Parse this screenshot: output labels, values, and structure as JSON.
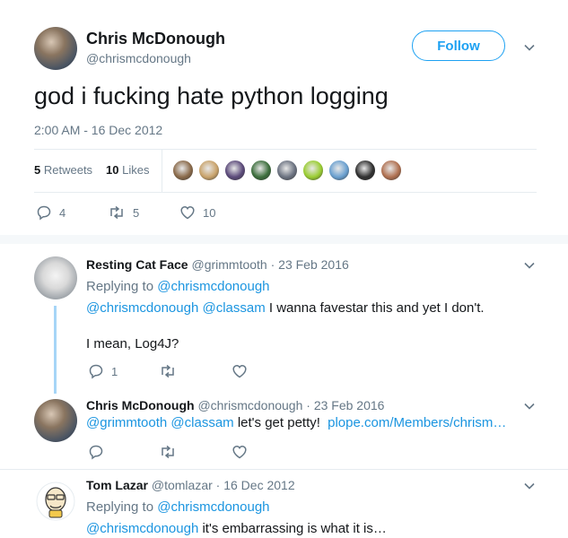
{
  "main_tweet": {
    "author_name": "Chris McDonough",
    "author_handle": "@chrismcdonough",
    "follow_label": "Follow",
    "text": "god i fucking hate python logging",
    "timestamp": "2:00 AM - 16 Dec 2012",
    "retweets_count": "5",
    "retweets_label": "Retweets",
    "likes_count": "10",
    "likes_label": "Likes",
    "likers": [
      "#8a6a4a",
      "#c9a36b",
      "#5b4a7a",
      "#3c6e3c",
      "#6b7280",
      "#9acd32",
      "#6aa0d0",
      "#2f2f2f",
      "#b07050"
    ],
    "reply_count": "4",
    "retweet_action_count": "5",
    "like_action_count": "10"
  },
  "replies": [
    {
      "name": "Resting Cat Face",
      "handle": "@grimmtooth",
      "date": "· 23 Feb 2016",
      "replying_prefix": "Replying to",
      "replying_to": "@chrismcdonough",
      "mention1": "@chrismcdonough",
      "mention2": "@classam",
      "text1": "I wanna favestar this and yet I don't.",
      "text2": "I mean, Log4J?",
      "reply_count": "1"
    },
    {
      "name": "Chris McDonough",
      "handle": "@chrismcdonough",
      "date": "· 23 Feb 2016",
      "mention1": "@grimmtooth",
      "mention2": "@classam",
      "text": "let's get petty!",
      "url": "plope.com/Members/chrism…"
    },
    {
      "name": "Tom Lazar",
      "handle": "@tomlazar",
      "date": "· 16 Dec 2012",
      "replying_prefix": "Replying to",
      "replying_to": "@chrismcdonough",
      "mention1": "@chrismcdonough",
      "text": "it's embarrassing is what it is…"
    }
  ],
  "colors": {
    "accent": "#1da1f2",
    "link": "#1b95e0",
    "muted": "#657786",
    "thread_line": "#a6d5f7"
  }
}
